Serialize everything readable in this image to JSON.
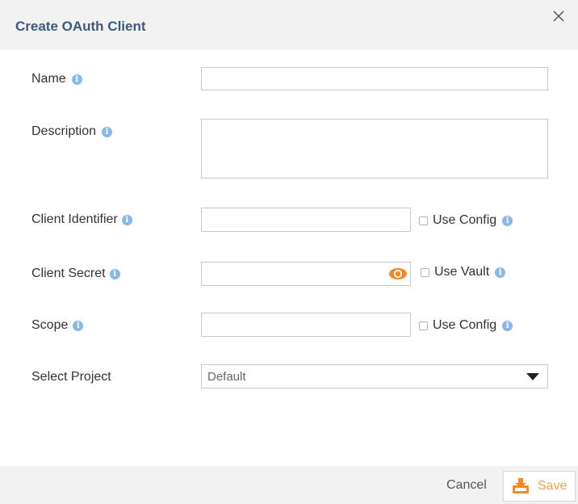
{
  "dialog": {
    "title": "Create OAuth Client",
    "close_icon": "close-icon"
  },
  "form": {
    "name": {
      "label": "Name",
      "value": ""
    },
    "description": {
      "label": "Description",
      "value": ""
    },
    "client_identifier": {
      "label": "Client Identifier",
      "value": "",
      "use_config_label": "Use Config",
      "use_config_checked": false
    },
    "client_secret": {
      "label": "Client Secret",
      "value": "",
      "use_vault_label": "Use Vault",
      "use_vault_checked": false,
      "reveal_icon": "eye-icon"
    },
    "scope": {
      "label": "Scope",
      "value": "",
      "use_config_label": "Use Config",
      "use_config_checked": false
    },
    "select_project": {
      "label": "Select Project",
      "selected": "Default"
    }
  },
  "footer": {
    "cancel_label": "Cancel",
    "save_label": "Save",
    "save_icon": "download-icon"
  },
  "colors": {
    "title": "#3d5a7a",
    "info_icon": "#8ab8e6",
    "accent": "#f0a050",
    "header_bg": "#f2f2f2"
  }
}
